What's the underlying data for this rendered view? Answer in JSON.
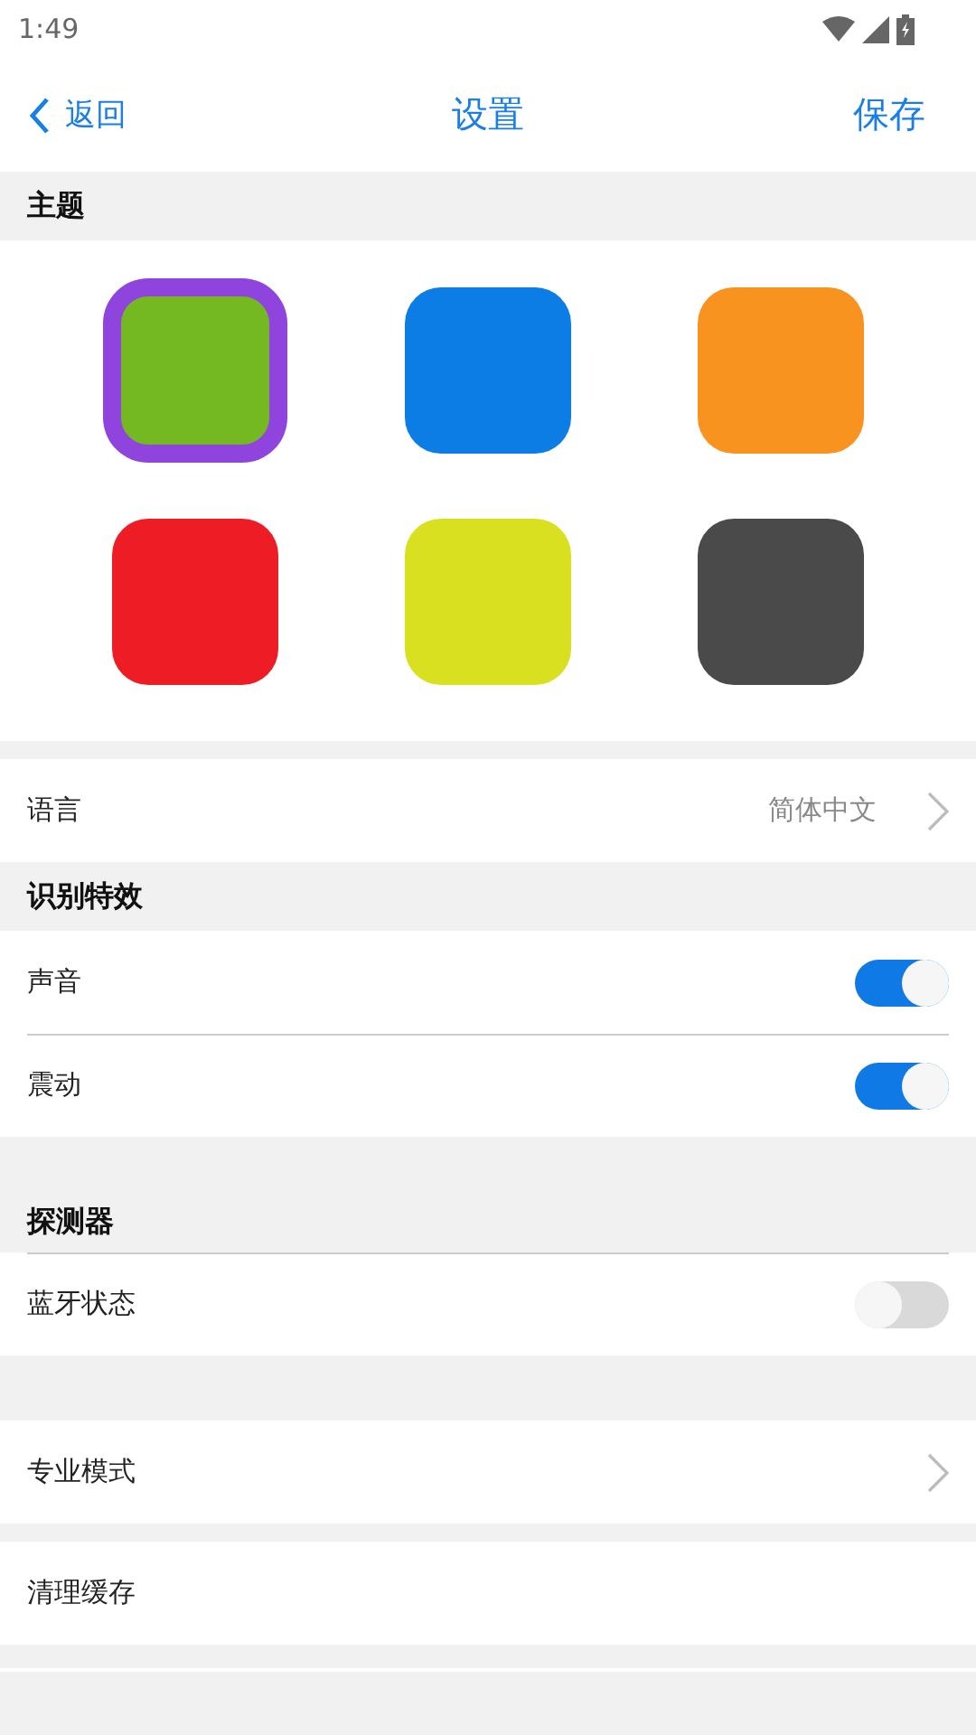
{
  "status_bar": {
    "time": "1:49"
  },
  "nav": {
    "back": "返回",
    "title": "设置",
    "action": "保存"
  },
  "theme": {
    "title": "主题",
    "swatches": [
      {
        "color": "#75b922",
        "selected": true
      },
      {
        "color": "#0d7de6",
        "selected": false
      },
      {
        "color": "#f7931e",
        "selected": false
      },
      {
        "color": "#ee1c24",
        "selected": false
      },
      {
        "color": "#d8e01f",
        "selected": false
      },
      {
        "color": "#4a4a4a",
        "selected": false
      }
    ]
  },
  "sections": [
    {
      "rows": [
        {
          "kind": "link",
          "label": "语言",
          "value": "简体中文"
        }
      ]
    },
    {
      "title": "识别特效",
      "rows": [
        {
          "kind": "toggle",
          "label": "声音",
          "on": true
        },
        {
          "kind": "toggle",
          "label": "震动",
          "on": true
        }
      ]
    },
    {
      "title": "探测器",
      "rows": [
        {
          "kind": "toggle",
          "label": "蓝牙状态",
          "on": false
        }
      ]
    },
    {
      "rows": [
        {
          "kind": "link",
          "label": "专业模式"
        }
      ]
    },
    {
      "rows": [
        {
          "kind": "plain",
          "label": "清理缓存"
        }
      ]
    }
  ]
}
